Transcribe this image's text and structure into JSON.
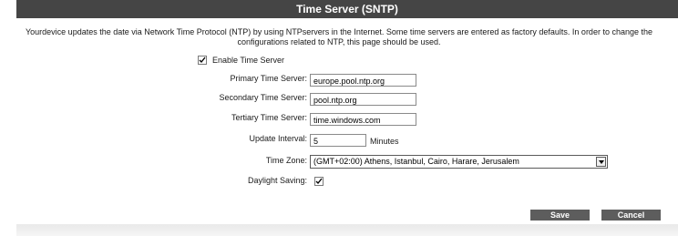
{
  "header": {
    "title": "Time Server (SNTP)"
  },
  "description": {
    "line1": "Yourdevice updates the date via Network Time Protocol (NTP) by using NTPservers in the Internet. Some time servers are entered as factory defaults. In order to change the",
    "line2": "configurations related to NTP, this page should be used."
  },
  "form": {
    "enable": {
      "label": "Enable Time Server",
      "checked": true
    },
    "primary": {
      "label": "Primary Time Server:",
      "value": "europe.pool.ntp.org"
    },
    "secondary": {
      "label": "Secondary Time Server:",
      "value": "pool.ntp.org"
    },
    "tertiary": {
      "label": "Tertiary Time Server:",
      "value": "time.windows.com"
    },
    "interval": {
      "label": "Update Interval:",
      "value": "5",
      "unit": "Minutes"
    },
    "timezone": {
      "label": "Time Zone:",
      "value": "(GMT+02:00) Athens, Istanbul, Cairo, Harare, Jerusalem"
    },
    "daylight": {
      "label": "Daylight Saving:",
      "checked": true
    }
  },
  "actions": {
    "save_label": "Save",
    "cancel_label": "Cancel"
  },
  "colors": {
    "header_bg": "#454545",
    "button_bg": "#5d5d5d"
  }
}
